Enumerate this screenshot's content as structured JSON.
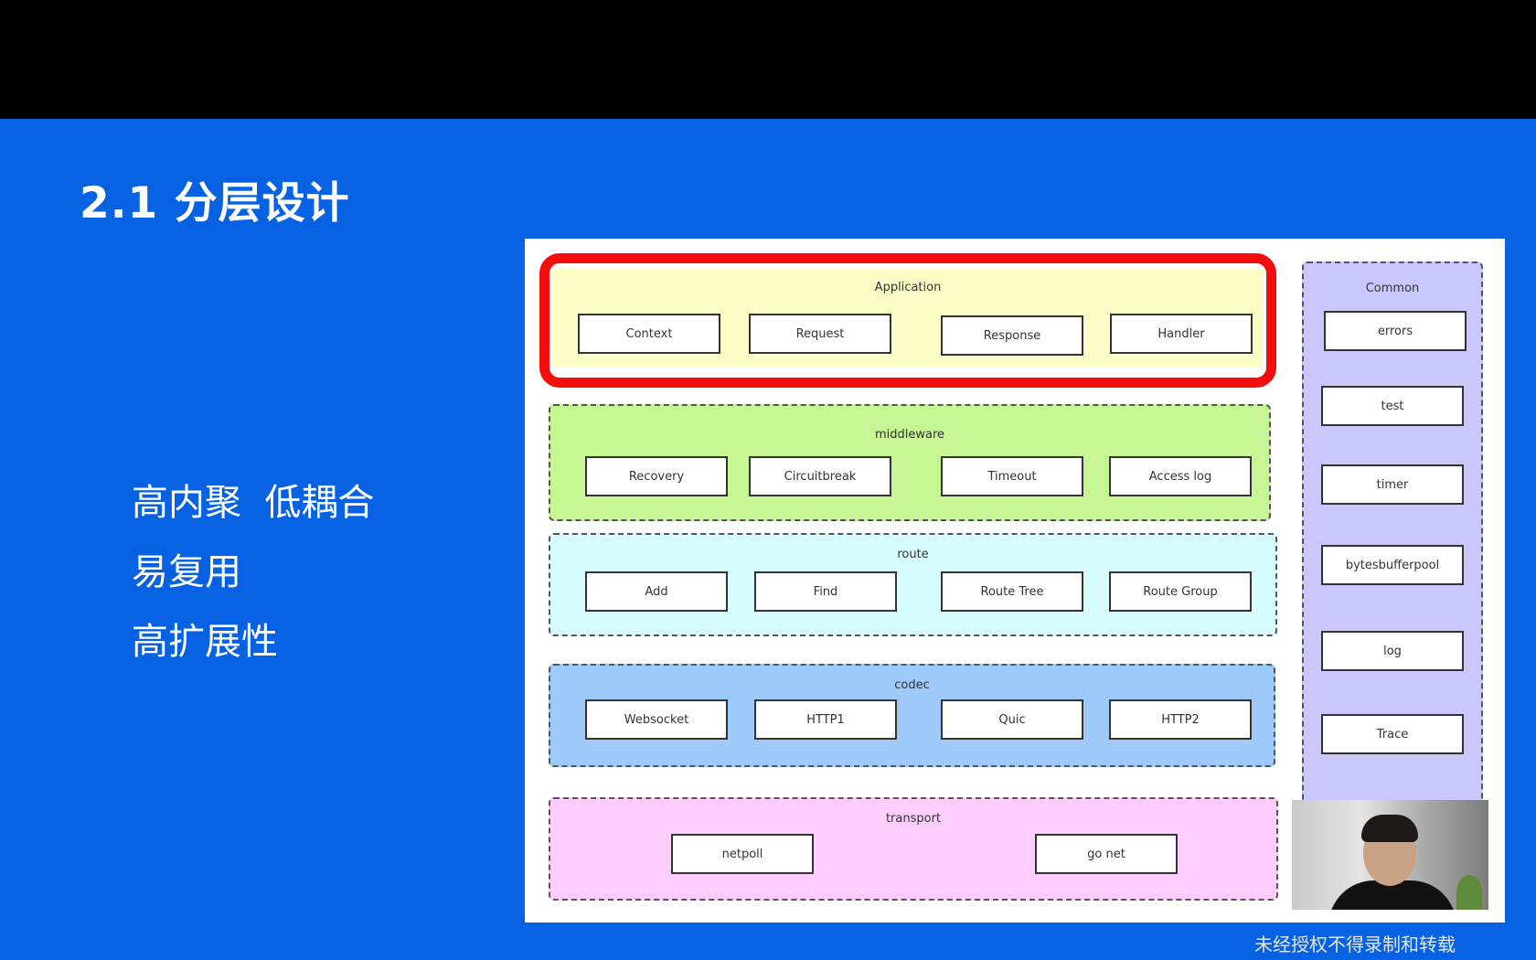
{
  "slide": {
    "title": "2.1  分层设计",
    "bullets": [
      "高内聚  低耦合",
      "易复用",
      "高扩展性"
    ]
  },
  "diagram": {
    "layers": [
      {
        "name": "Application",
        "color": "#fdfdc8",
        "items": [
          "Context",
          "Request",
          "Response",
          "Handler"
        ],
        "highlighted": true
      },
      {
        "name": "middleware",
        "color": "#c8f593",
        "items": [
          "Recovery",
          "Circuitbreak",
          "Timeout",
          "Access log"
        ]
      },
      {
        "name": "route",
        "color": "#d6fcfd",
        "items": [
          "Add",
          "Find",
          "Route Tree",
          "Route Group"
        ]
      },
      {
        "name": "codec",
        "color": "#9dc9fb",
        "items": [
          "Websocket",
          "HTTP1",
          "Quic",
          "HTTP2"
        ]
      },
      {
        "name": "transport",
        "color": "#fdcdfd",
        "items": [
          "netpoll",
          "go net"
        ]
      }
    ],
    "common": {
      "name": "Common",
      "color": "#c9c7fc",
      "items": [
        "errors",
        "test",
        "timer",
        "bytesbufferpool",
        "log",
        "Trace"
      ]
    },
    "highlight_color": "#f50d0d"
  },
  "watermark": "未经授权不得录制和转载"
}
